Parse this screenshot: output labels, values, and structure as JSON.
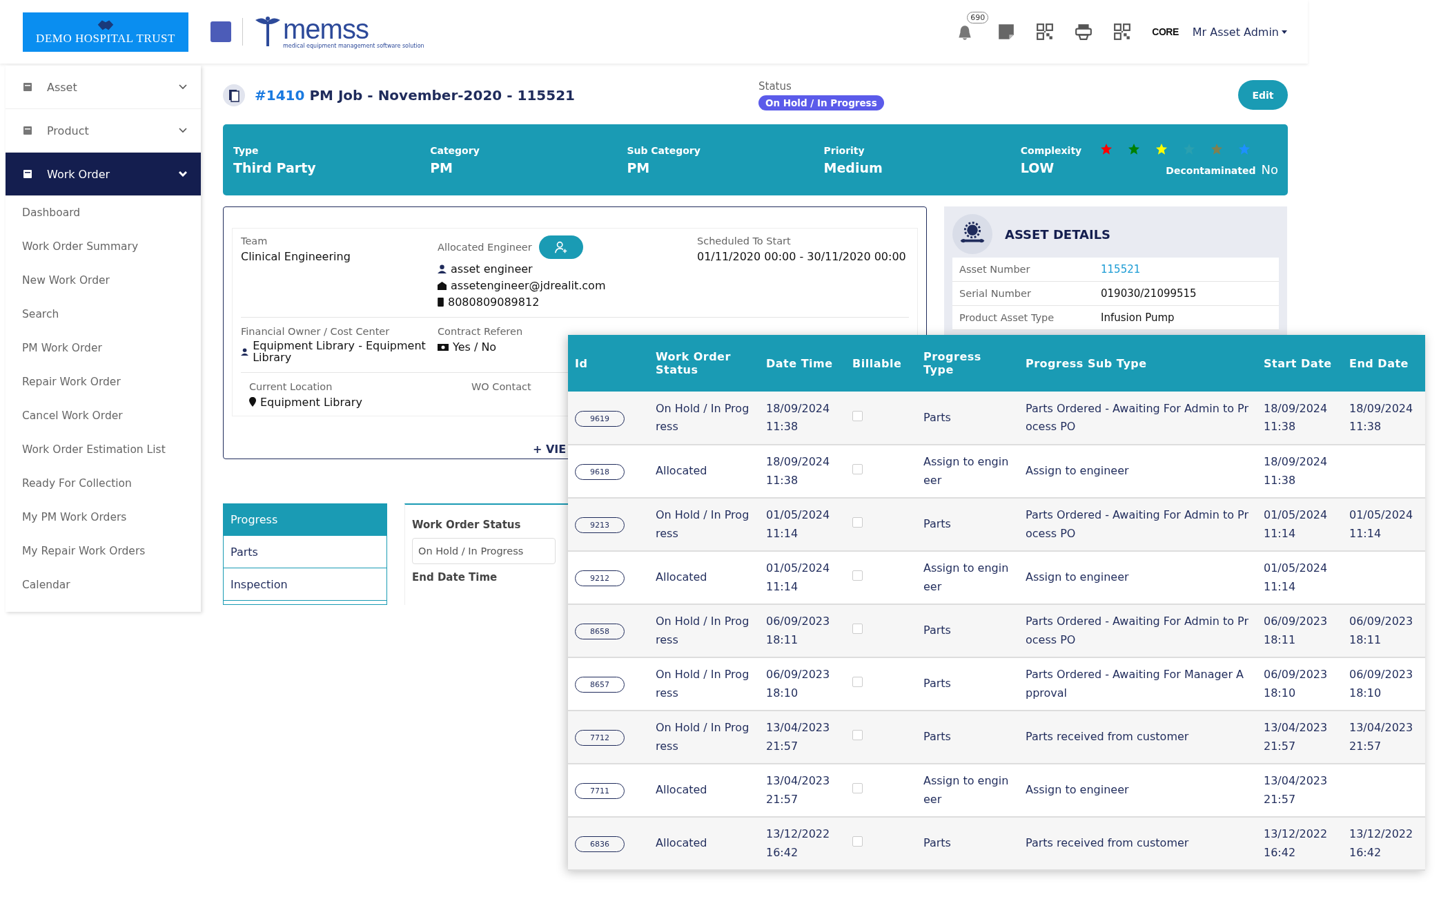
{
  "header": {
    "org_logo": "DEMO HOSPITAL TRUST",
    "app_logo": "memss",
    "app_tagline": "medical equipment management software solution",
    "notification_count": "690",
    "brand_logo": "CORE",
    "user_menu": "Mr Asset Admin"
  },
  "sidebar": {
    "items": [
      {
        "label": "Asset",
        "selected": false,
        "expanded": false
      },
      {
        "label": "Product",
        "selected": false,
        "expanded": false
      },
      {
        "label": "Work Order",
        "selected": true,
        "expanded": true,
        "children": [
          {
            "label": "Dashboard"
          },
          {
            "label": "Work Order Summary"
          },
          {
            "label": "New Work Order"
          },
          {
            "label": "Search"
          },
          {
            "label": "PM Work Order"
          },
          {
            "label": "Repair Work Order"
          },
          {
            "label": "Cancel Work Order"
          },
          {
            "label": "Work Order Estimation List"
          },
          {
            "label": "Ready For Collection"
          },
          {
            "label": "My PM Work Orders"
          },
          {
            "label": "My Repair Work Orders"
          },
          {
            "label": "Calendar"
          }
        ]
      }
    ]
  },
  "job": {
    "number": "#1410",
    "title": "PM Job - November-2020 - 115521",
    "status_label": "Status",
    "status": "On Hold / In Progress",
    "edit_button": "Edit"
  },
  "summary": {
    "fields": [
      {
        "label": "Type",
        "value": "Third Party"
      },
      {
        "label": "Category",
        "value": "PM"
      },
      {
        "label": "Sub Category",
        "value": "PM"
      },
      {
        "label": "Priority",
        "value": "Medium"
      },
      {
        "label": "Complexity",
        "value": "LOW"
      }
    ],
    "stars": [
      {
        "color": "#ff0000"
      },
      {
        "color": "#008000"
      },
      {
        "color": "#ffff00"
      },
      {
        "color": "#2aa0b0"
      },
      {
        "color": "#808050"
      },
      {
        "color": "#1e90ff"
      }
    ],
    "decontaminated_label": "Decontaminated",
    "decontaminated": "No"
  },
  "details": {
    "team_label": "Team",
    "team": "Clinical Engineering",
    "engineer_label": "Allocated Engineer",
    "engineer_name": "asset engineer",
    "engineer_email": "assetengineer@jdrealit.com",
    "engineer_phone": "8080809089812",
    "scheduled_label": "Scheduled To Start",
    "scheduled": "01/11/2020 00:00 - 30/11/2020 00:00",
    "owner_label": "Financial Owner / Cost Center",
    "owner": "Equipment Library - Equipment Library",
    "contract_label": "Contract Referen",
    "contract": "Yes / No",
    "location_label": "Current Location",
    "location": "Equipment Library",
    "contact_label": "WO Contact",
    "view_more": "+ VIE"
  },
  "asset_details": {
    "title": "ASSET DETAILS",
    "rows": [
      {
        "label": "Asset Number",
        "value": "115521",
        "kind": "link"
      },
      {
        "label": "Serial Number",
        "value": "019030/21099515",
        "kind": "text"
      },
      {
        "label": "Product Asset Type",
        "value": "Infusion Pump",
        "kind": "text"
      }
    ]
  },
  "tabs": [
    {
      "label": "Progress",
      "selected": true
    },
    {
      "label": "Parts",
      "selected": false
    },
    {
      "label": "Inspection",
      "selected": false
    }
  ],
  "form": {
    "status_label": "Work Order Status",
    "status_value": "On Hold / In Progress",
    "end_label": "End Date Time"
  },
  "progress_table": {
    "columns": [
      "Id",
      "Work Order Status",
      "Date Time",
      "Billable",
      "Progress Type",
      "Progress Sub Type",
      "Start Date",
      "End Date"
    ],
    "rows": [
      {
        "id": "9619",
        "status": "On Hold / In Progress",
        "date_time": "18/09/2024 11:38",
        "billable": false,
        "type": "Parts",
        "sub_type": "Parts Ordered - Awaiting For Admin to Process PO",
        "start": "18/09/2024 11:38",
        "end": "18/09/2024 11:38"
      },
      {
        "id": "9618",
        "status": "Allocated",
        "date_time": "18/09/2024 11:38",
        "billable": false,
        "type": "Assign to engineer",
        "sub_type": "Assign to engineer",
        "start": "18/09/2024 11:38",
        "end": ""
      },
      {
        "id": "9213",
        "status": "On Hold / In Progress",
        "date_time": "01/05/2024 11:14",
        "billable": false,
        "type": "Parts",
        "sub_type": "Parts Ordered - Awaiting For Admin to Process PO",
        "start": "01/05/2024 11:14",
        "end": "01/05/2024 11:14"
      },
      {
        "id": "9212",
        "status": "Allocated",
        "date_time": "01/05/2024 11:14",
        "billable": false,
        "type": "Assign to engineer",
        "sub_type": "Assign to engineer",
        "start": "01/05/2024 11:14",
        "end": ""
      },
      {
        "id": "8658",
        "status": "On Hold / In Progress",
        "date_time": "06/09/2023 18:11",
        "billable": false,
        "type": "Parts",
        "sub_type": "Parts Ordered - Awaiting For Admin to Process PO",
        "start": "06/09/2023 18:11",
        "end": "06/09/2023 18:11"
      },
      {
        "id": "8657",
        "status": "On Hold / In Progress",
        "date_time": "06/09/2023 18:10",
        "billable": false,
        "type": "Parts",
        "sub_type": "Parts Ordered - Awaiting For Manager Approval",
        "start": "06/09/2023 18:10",
        "end": "06/09/2023 18:10"
      },
      {
        "id": "7712",
        "status": "On Hold / In Progress",
        "date_time": "13/04/2023 21:57",
        "billable": false,
        "type": "Parts",
        "sub_type": "Parts received from customer",
        "start": "13/04/2023 21:57",
        "end": "13/04/2023 21:57"
      },
      {
        "id": "7711",
        "status": "Allocated",
        "date_time": "13/04/2023 21:57",
        "billable": false,
        "type": "Assign to engineer",
        "sub_type": "Assign to engineer",
        "start": "13/04/2023 21:57",
        "end": ""
      },
      {
        "id": "6836",
        "status": "Allocated",
        "date_time": "13/12/2022 16:42",
        "billable": false,
        "type": "Parts",
        "sub_type": "Parts received from customer",
        "start": "13/12/2022 16:42",
        "end": "13/12/2022 16:42"
      }
    ]
  }
}
